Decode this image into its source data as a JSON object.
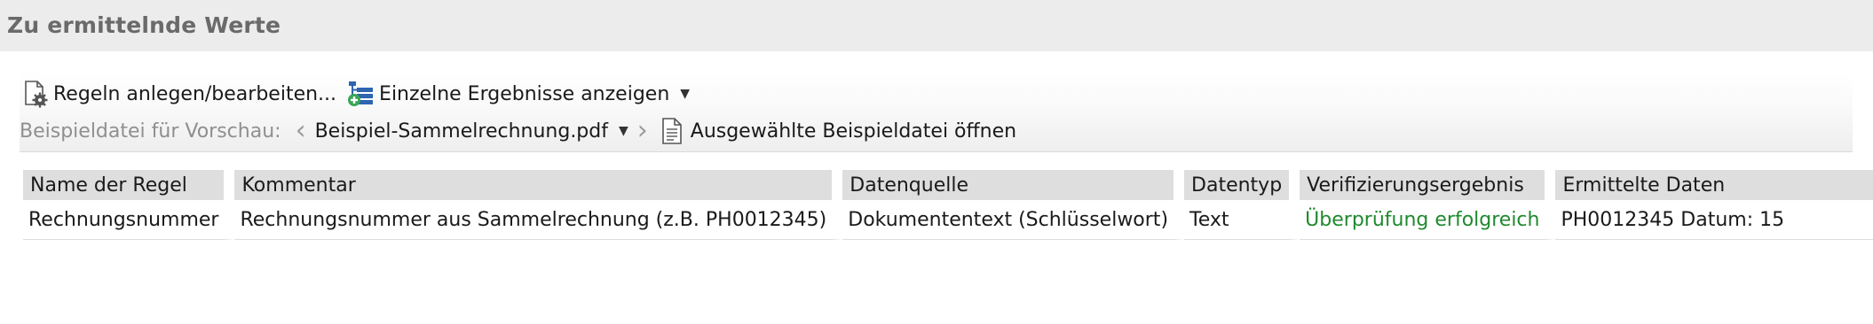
{
  "section": {
    "title": "Zu ermittelnde Werte"
  },
  "toolbar": {
    "rules_label": "Regeln anlegen/bearbeiten...",
    "results_label": "Einzelne Ergebnisse anzeigen",
    "preview_label": "Beispieldatei für Vorschau:",
    "selected_file": "Beispiel-Sammelrechnung.pdf",
    "open_file_label": "Ausgewählte Beispieldatei öffnen"
  },
  "table": {
    "columns": [
      "Name der Regel",
      "Kommentar",
      "Datenquelle",
      "Datentyp",
      "Verifizierungsergebnis",
      "Ermittelte Daten"
    ],
    "rows": [
      {
        "name": "Rechnungsnummer",
        "comment": "Rechnungsnummer aus Sammelrechnung (z.B. PH0012345)",
        "source": "Dokumententext (Schlüsselwort)",
        "type": "Text",
        "verification": "Überprüfung erfolgreich",
        "data": "PH0012345 Datum: 15"
      }
    ]
  },
  "colors": {
    "success": "#1f8a2e",
    "header_bg": "#dedede",
    "section_bg": "#ececec"
  }
}
